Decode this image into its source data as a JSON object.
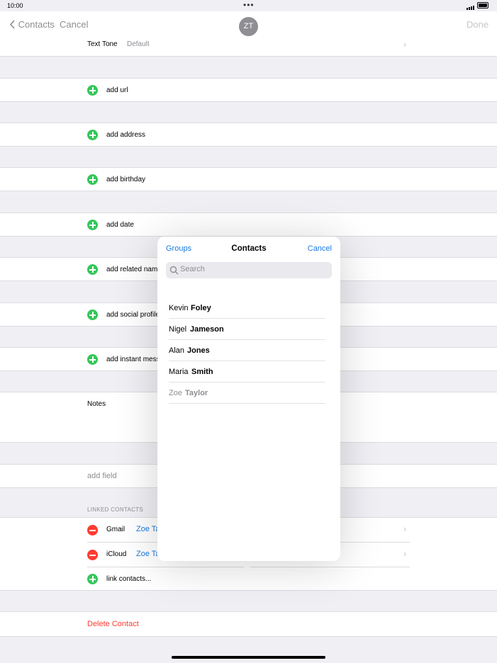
{
  "status": {
    "time": "10:00"
  },
  "nav": {
    "back_label": "Contacts",
    "cancel_label": "Cancel",
    "done_label": "Done",
    "avatar_initials": "ZT"
  },
  "text_tone": {
    "label": "Text Tone",
    "value": "Default"
  },
  "add_rows": [
    {
      "label": "add url"
    },
    {
      "label": "add address"
    },
    {
      "label": "add birthday"
    },
    {
      "label": "add date"
    },
    {
      "label": "add related name"
    },
    {
      "label": "add social profile"
    },
    {
      "label": "add instant message"
    }
  ],
  "notes": {
    "label": "Notes"
  },
  "add_field": {
    "label": "add field"
  },
  "linked_contacts": {
    "header": "LINKED CONTACTS",
    "items": [
      {
        "source": "Gmail",
        "name": "Zoe Taylor"
      },
      {
        "source": "iCloud",
        "name": "Zoe Taylor"
      }
    ],
    "link_label": "link contacts..."
  },
  "delete_label": "Delete Contact",
  "popover": {
    "groups_label": "Groups",
    "title": "Contacts",
    "cancel_label": "Cancel",
    "search_placeholder": "Search",
    "contacts": [
      {
        "first": "Kevin",
        "last": "Foley",
        "disabled": false
      },
      {
        "first": "Nigel",
        "last": "Jameson",
        "disabled": false
      },
      {
        "first": "Alan",
        "last": "Jones",
        "disabled": false
      },
      {
        "first": "Maria",
        "last": "Smith",
        "disabled": false
      },
      {
        "first": "Zoe",
        "last": "Taylor",
        "disabled": true
      }
    ]
  },
  "colors": {
    "accent": "#1a7ae0",
    "add_green": "#34c759",
    "delete_red": "#ff3b30"
  }
}
